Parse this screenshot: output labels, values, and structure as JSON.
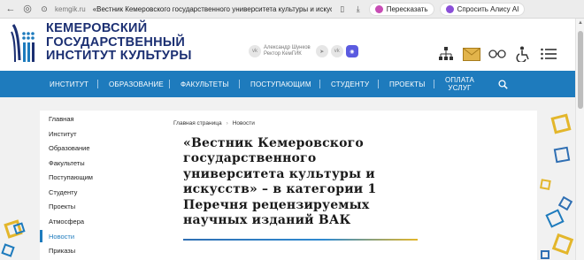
{
  "browser": {
    "back_icon": "back-arrow-icon",
    "url": "kemgik.ru",
    "tab_title": "«Вестник Кемеровского государственного университета культуры и искусс...",
    "translate_label": "Пересказать",
    "alice_label": "Спросить Алису AI"
  },
  "header": {
    "logo_line1": "КЕМЕРОВСКИЙ",
    "logo_line2": "ГОСУДАРСТВЕННЫЙ",
    "logo_line3": "ИНСТИТУТ КУЛЬТУРЫ",
    "rector_name": "Александр Шунков",
    "rector_title": "Ректор КемГИК"
  },
  "nav": {
    "items": [
      "ИНСТИТУТ",
      "ОБРАЗОВАНИЕ",
      "ФАКУЛЬТЕТЫ",
      "ПОСТУПАЮЩИМ",
      "СТУДЕНТУ",
      "ПРОЕКТЫ",
      "ОПЛАТА",
      "УСЛУГ"
    ]
  },
  "sidebar": {
    "items": [
      "Главная",
      "Институт",
      "Образование",
      "Факультеты",
      "Поступающим",
      "Студенту",
      "Проекты",
      "Атмосфера",
      "Новости",
      "Приказы"
    ],
    "active": "Новости"
  },
  "content": {
    "breadcrumb_home": "Главная страница",
    "breadcrumb_current": "Новости",
    "title": "«Вестник Кемеровского государственного университета культуры и искусств» – в категории 1 Перечня рецензируемых научных изданий ВАК"
  },
  "colors": {
    "nav_bg": "#1e7bbd",
    "logo_blue": "#1b2f72",
    "accent_yellow": "#e3b62b"
  }
}
